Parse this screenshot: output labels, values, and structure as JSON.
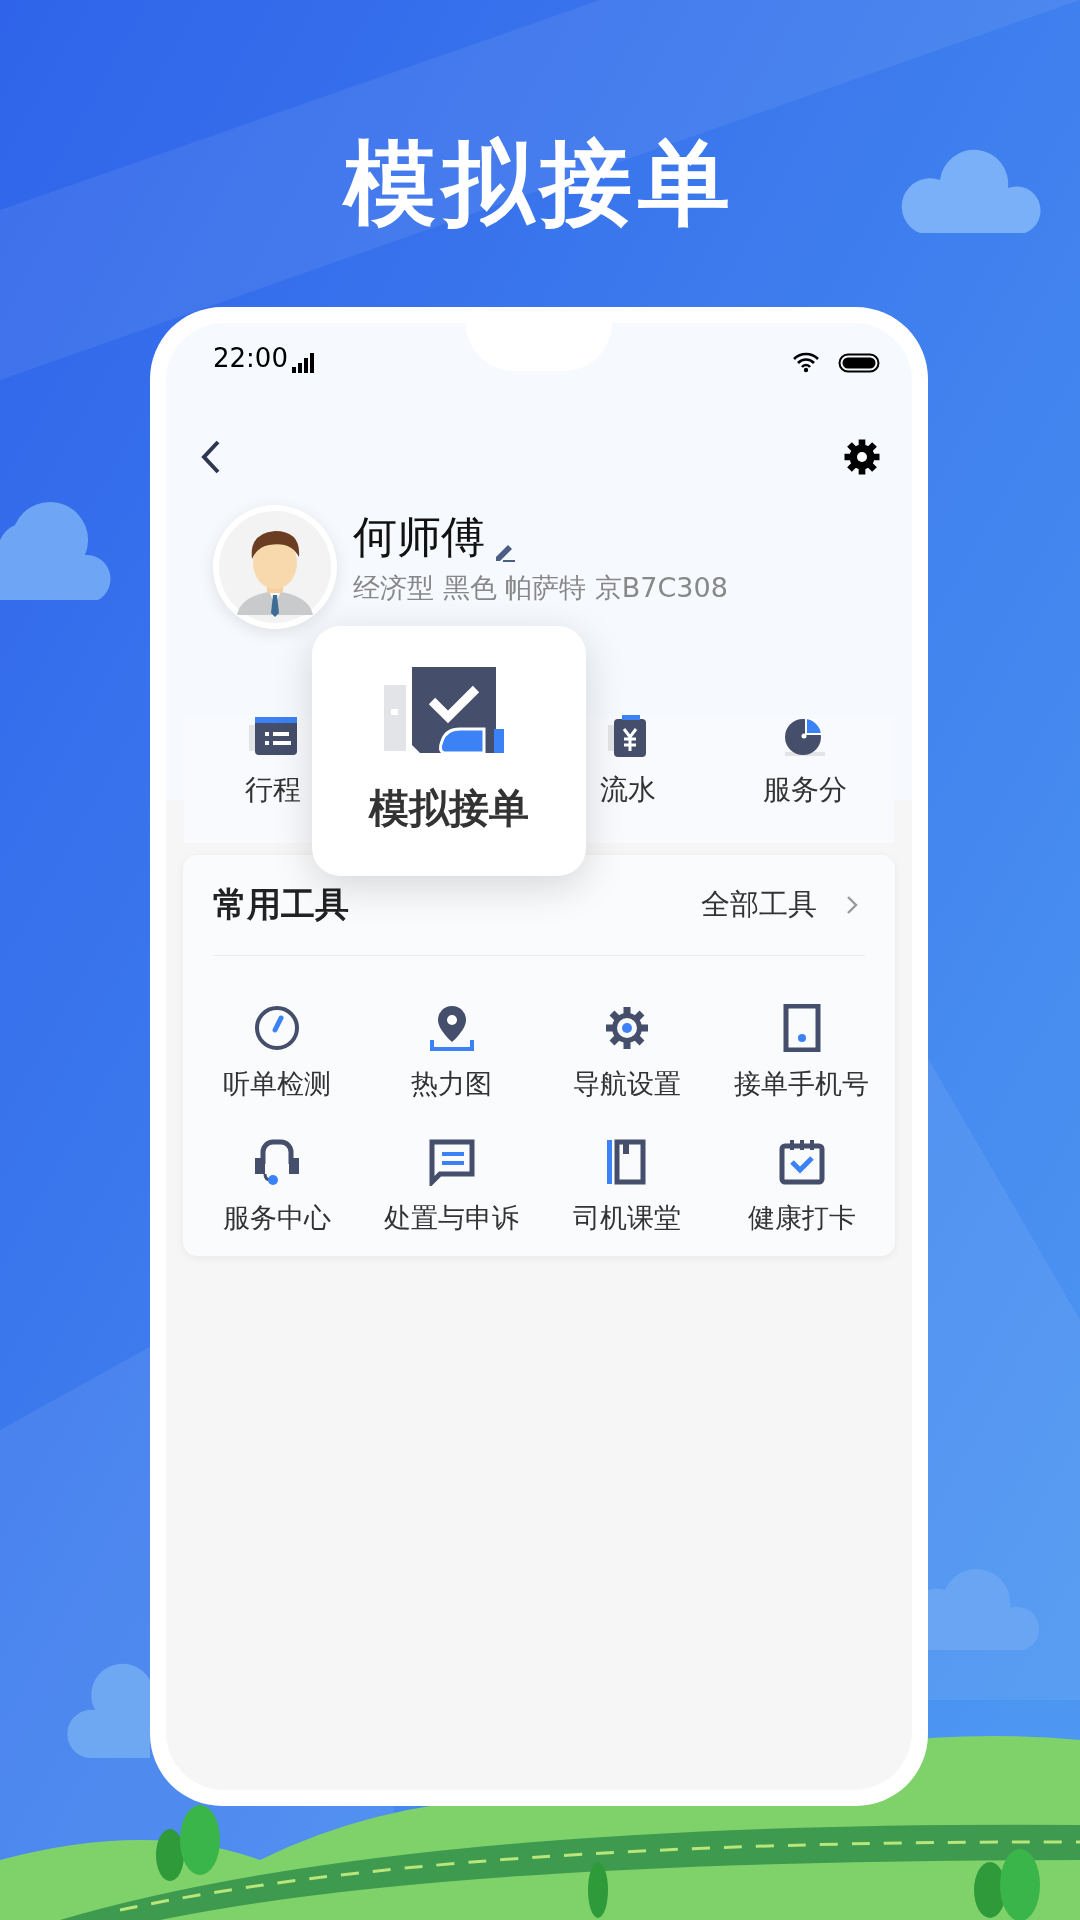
{
  "headline": "模拟接单",
  "status_bar": {
    "time": "22:00"
  },
  "profile": {
    "name": "何师傅",
    "vehicle": "经济型 黑色 帕萨特 京B7C308"
  },
  "quick_actions": [
    {
      "label": "行程",
      "kind": "list"
    },
    {
      "label": "流水",
      "kind": "yuan"
    },
    {
      "label": "服务分",
      "kind": "pie"
    }
  ],
  "popup": {
    "label": "模拟接单"
  },
  "tools": {
    "title": "常用工具",
    "more": "全部工具",
    "items": [
      {
        "label": "听单检测",
        "kind": "gauge"
      },
      {
        "label": "热力图",
        "kind": "pin"
      },
      {
        "label": "导航设置",
        "kind": "gear"
      },
      {
        "label": "接单手机号",
        "kind": "phone"
      },
      {
        "label": "服务中心",
        "kind": "headset"
      },
      {
        "label": "处置与申诉",
        "kind": "chat"
      },
      {
        "label": "司机课堂",
        "kind": "book"
      },
      {
        "label": "健康打卡",
        "kind": "calendar"
      }
    ]
  }
}
